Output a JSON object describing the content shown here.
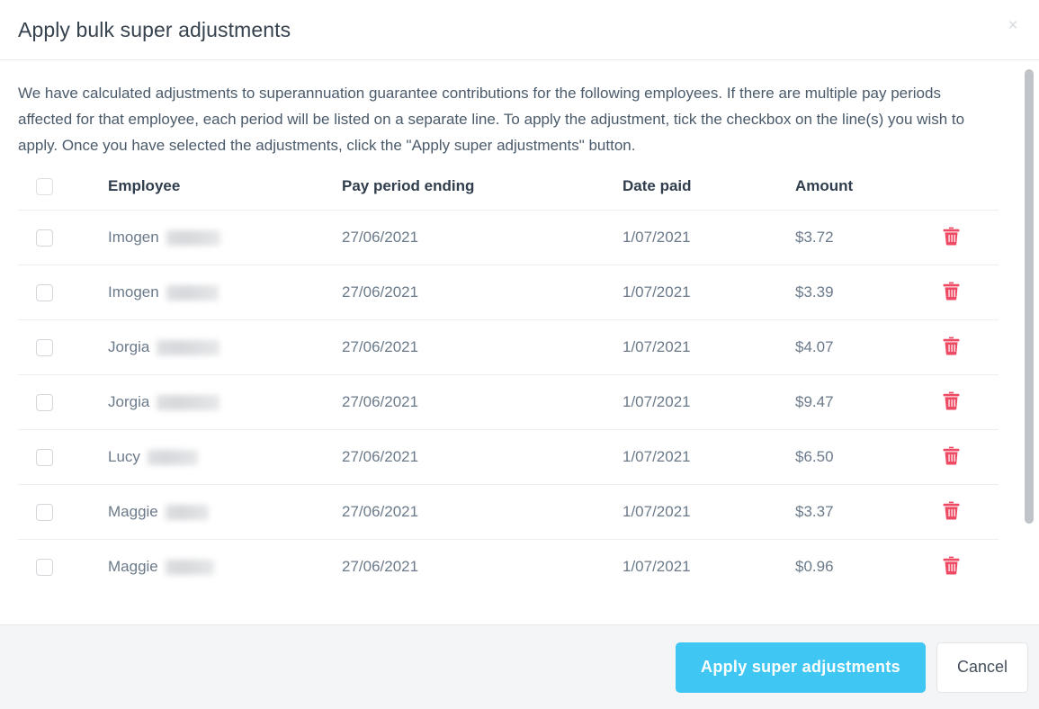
{
  "modal": {
    "title": "Apply bulk super adjustments",
    "close_icon_label": "×",
    "intro_text": "We have calculated adjustments to superannuation guarantee contributions for the following employees. If there are multiple pay periods affected for that employee, each period will be listed on a separate line. To apply the adjustment, tick the checkbox on the line(s) you wish to apply. Once you have selected the adjustments, click the \"Apply super adjustments\" button."
  },
  "table": {
    "headers": {
      "employee": "Employee",
      "pay_period_ending": "Pay period ending",
      "date_paid": "Date paid",
      "amount": "Amount"
    },
    "rows": [
      {
        "employee_first": "Imogen",
        "employee_redacted_width": 60,
        "pay_period_ending": "27/06/2021",
        "date_paid": "1/07/2021",
        "amount": "$3.72"
      },
      {
        "employee_first": "Imogen",
        "employee_redacted_width": 58,
        "pay_period_ending": "27/06/2021",
        "date_paid": "1/07/2021",
        "amount": "$3.39"
      },
      {
        "employee_first": "Jorgia",
        "employee_redacted_width": 70,
        "pay_period_ending": "27/06/2021",
        "date_paid": "1/07/2021",
        "amount": "$4.07"
      },
      {
        "employee_first": "Jorgia",
        "employee_redacted_width": 70,
        "pay_period_ending": "27/06/2021",
        "date_paid": "1/07/2021",
        "amount": "$9.47"
      },
      {
        "employee_first": "Lucy",
        "employee_redacted_width": 56,
        "pay_period_ending": "27/06/2021",
        "date_paid": "1/07/2021",
        "amount": "$6.50"
      },
      {
        "employee_first": "Maggie",
        "employee_redacted_width": 48,
        "pay_period_ending": "27/06/2021",
        "date_paid": "1/07/2021",
        "amount": "$3.37"
      },
      {
        "employee_first": "Maggie",
        "employee_redacted_width": 54,
        "pay_period_ending": "27/06/2021",
        "date_paid": "1/07/2021",
        "amount": "$0.96"
      }
    ],
    "delete_icon_name": "trash-icon"
  },
  "footer": {
    "apply_label": "Apply super adjustments",
    "cancel_label": "Cancel"
  },
  "colors": {
    "primary_button": "#3fc6f2",
    "delete_icon": "#ef4a64",
    "title_text": "#36424e",
    "body_text": "#4a5a6a",
    "footer_bg": "#f4f5f6"
  }
}
